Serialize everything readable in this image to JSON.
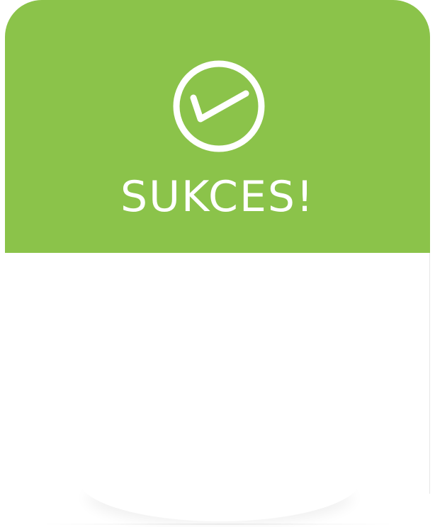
{
  "dialog": {
    "title": "SUKCES!",
    "icon": "check-circle-icon",
    "accent_color": "#8bc34a",
    "body_text": ""
  }
}
